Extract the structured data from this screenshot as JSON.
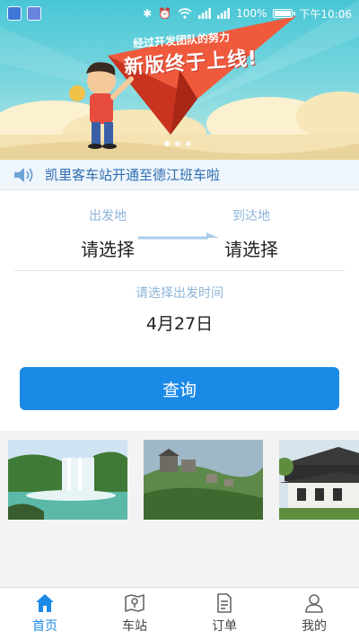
{
  "status_bar": {
    "battery": "100%",
    "battery_level": 1.0,
    "time": "下午10:06"
  },
  "banner": {
    "line1": "经过开发团队的努力",
    "line2": "新版终于上线!",
    "slides": 3,
    "active_slide": 0,
    "colors": {
      "sky": "#48c6d6",
      "plane": "#e8432d",
      "cloud": "#f6e6b8"
    }
  },
  "notice": {
    "icon": "speaker-icon",
    "text": "凯里客车站开通至德江班车啦"
  },
  "search": {
    "departure_label": "出发地",
    "departure_value": "请选择",
    "arrival_label": "到达地",
    "arrival_value": "请选择",
    "time_label": "请选择出发时间",
    "date_value": "4月27日",
    "submit_label": "查询"
  },
  "scenic": [
    {
      "icon": "waterfall-photo"
    },
    {
      "icon": "mountain-village-photo"
    },
    {
      "icon": "traditional-building-photo"
    }
  ],
  "tabbar": {
    "active": "home",
    "items": [
      {
        "id": "home",
        "label": "首页",
        "icon": "home-icon"
      },
      {
        "id": "station",
        "label": "车站",
        "icon": "map-icon"
      },
      {
        "id": "orders",
        "label": "订单",
        "icon": "document-icon"
      },
      {
        "id": "mine",
        "label": "我的",
        "icon": "user-icon"
      }
    ]
  },
  "theme": {
    "accent": "#1b8ae6",
    "label_color": "#8eb4d8"
  }
}
